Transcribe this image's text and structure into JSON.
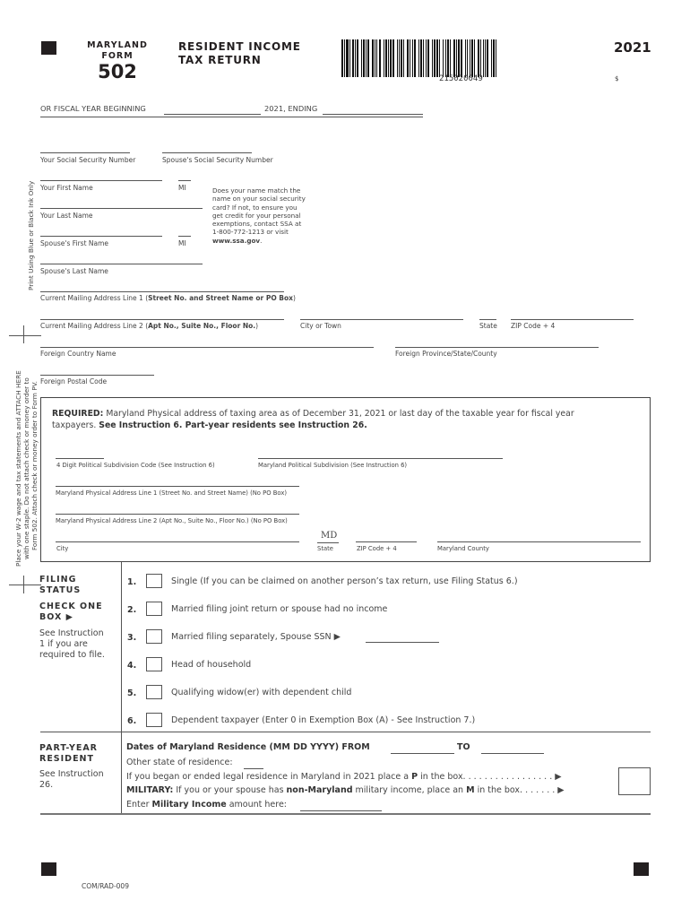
{
  "header": {
    "state": "MARYLAND",
    "form_label": "FORM",
    "form_number": "502",
    "title_line1": "RESIDENT INCOME",
    "title_line2": "TAX RETURN",
    "barcode_number": "215020049",
    "year": "2021",
    "dollar_sign": "$"
  },
  "fiscal_year": {
    "beginning_label": "OR FISCAL YEAR BEGINNING",
    "beginning_value": "",
    "ending_label": "2021, ENDING",
    "ending_value": ""
  },
  "side_notes": {
    "ink_note": "Print Using Blue or Black Ink Only",
    "attach_line1": "Place your W-2 wage and tax statements and ATTACH HERE",
    "attach_line2": "with one staple. Do not attach check or money order to",
    "attach_line3": "Form 502.  Attach check or money order to Form PV."
  },
  "taxpayer": {
    "ssn_label": "Your Social Security Number",
    "spouse_ssn_label": "Spouse's Social Security Number",
    "first_name_label": "Your First Name",
    "mi_label": "MI",
    "last_name_label": "Your Last Name",
    "spouse_first_name_label": "Spouse's First Name",
    "spouse_mi_label": "MI",
    "spouse_last_name_label": "Spouse's Last Name",
    "name_note_line1": "Does your name match the",
    "name_note_line2": "name on your social security",
    "name_note_line3": "card? If not, to ensure you",
    "name_note_line4": "get credit for your personal",
    "name_note_line5": "exemptions, contact SSA at",
    "name_note_line6": "1-800-772-1213 or visit",
    "name_note_link": "www.ssa.gov",
    "values": {
      "ssn": "",
      "spouse_ssn": "",
      "first_name": "",
      "mi": "",
      "last_name": "",
      "spouse_first_name": "",
      "spouse_mi": "",
      "spouse_last_name": ""
    }
  },
  "mailing": {
    "line1_label_pre": "Current Mailing Address Line 1 (",
    "line1_label_bold": "Street No. and Street Name or PO Box",
    "line1_label_post": ")",
    "line2_label_pre": "Current Mailing Address Line 2 (",
    "line2_label_bold": "Apt No., Suite No., Floor No.",
    "line2_label_post": ")",
    "city_label": "City or Town",
    "state_label": "State",
    "zip_label": "ZIP Code + 4",
    "foreign_country_label": "Foreign Country Name",
    "foreign_province_label": "Foreign Province/State/County",
    "foreign_postal_label": "Foreign Postal Code",
    "values": {
      "line1": "",
      "line2": "",
      "city": "",
      "state": "",
      "zip": "",
      "foreign_country": "",
      "foreign_province": "",
      "foreign_postal": ""
    }
  },
  "physical": {
    "required_bold": "REQUIRED:",
    "required_text": " Maryland Physical address of taxing area as of December 31, 2021 or last day of the taxable year for fiscal year",
    "required_text2": "taxpayers. ",
    "required_bold2": "See Instruction 6. Part-year residents see Instruction 26.",
    "subdivision_code_label": "4 Digit Political Subdivision Code (See Instruction 6)",
    "subdivision_label": "Maryland Political Subdivision (See Instruction 6)",
    "address1_label": "Maryland Physical Address Line 1 (Street No. and Street Name) (No PO Box)",
    "address2_label": "Maryland Physical Address Line 2 (Apt No., Suite No., Floor No.) (No PO Box)",
    "city_label": "City",
    "state_label": "State",
    "state_value": "MD",
    "zip_label": "ZIP Code + 4",
    "county_label": "Maryland County",
    "values": {
      "subdivision_code": "",
      "subdivision": "",
      "address1": "",
      "address2": "",
      "city": "",
      "zip": "",
      "county": ""
    }
  },
  "filing_status": {
    "title_line1": "FILING",
    "title_line2": "STATUS",
    "check_line1": "CHECK ONE",
    "check_line2": "BOX ▶",
    "note_line1": "See Instruction",
    "note_line2": "1 if you are",
    "note_line3": "required to file.",
    "options": [
      {
        "num": "1.",
        "text": "Single (If you can be claimed on another person’s tax return, use Filing Status 6.)",
        "checked": false
      },
      {
        "num": "2.",
        "text": "Married filing joint return or spouse had no income",
        "checked": false
      },
      {
        "num": "3.",
        "text": "Married filing separately, Spouse SSN ▶",
        "checked": false
      },
      {
        "num": "4.",
        "text": "Head of household",
        "checked": false
      },
      {
        "num": "5.",
        "text": "Qualifying widow(er) with dependent child",
        "checked": false
      },
      {
        "num": "6.",
        "text": "Dependent taxpayer (Enter 0 in Exemption Box (A) -  See Instruction 7.)",
        "checked": false
      }
    ],
    "spouse_ssn_value": ""
  },
  "part_year": {
    "title_line1": "PART-YEAR",
    "title_line2": "RESIDENT",
    "note_line1": "See Instruction",
    "note_line2": "26.",
    "dates_label": "Dates of Maryland Residence (MM DD YYYY) FROM",
    "to_label": "TO",
    "from_value": "",
    "to_value": "",
    "other_state_label": "Other state of residence:",
    "other_state_value": "",
    "p_line_pre": "If you began or ended legal residence in Maryland in 2021 place a ",
    "p_line_bold": "P",
    "p_line_post": " in the box. . . . . . . . . . . . . . . . .  ▶",
    "military_bold": "MILITARY:",
    "military_pre": " If you or your spouse has ",
    "military_bold2": "non-Maryland",
    "military_mid": " military income, place an ",
    "military_bold3": "M",
    "military_post": " in the box. . . . . . .  ▶",
    "military_income_pre": "Enter ",
    "military_income_bold": "Military Income",
    "military_income_post": " amount here:",
    "military_income_value": "",
    "box_value": ""
  },
  "footer": {
    "code": "COM/RAD-009"
  }
}
